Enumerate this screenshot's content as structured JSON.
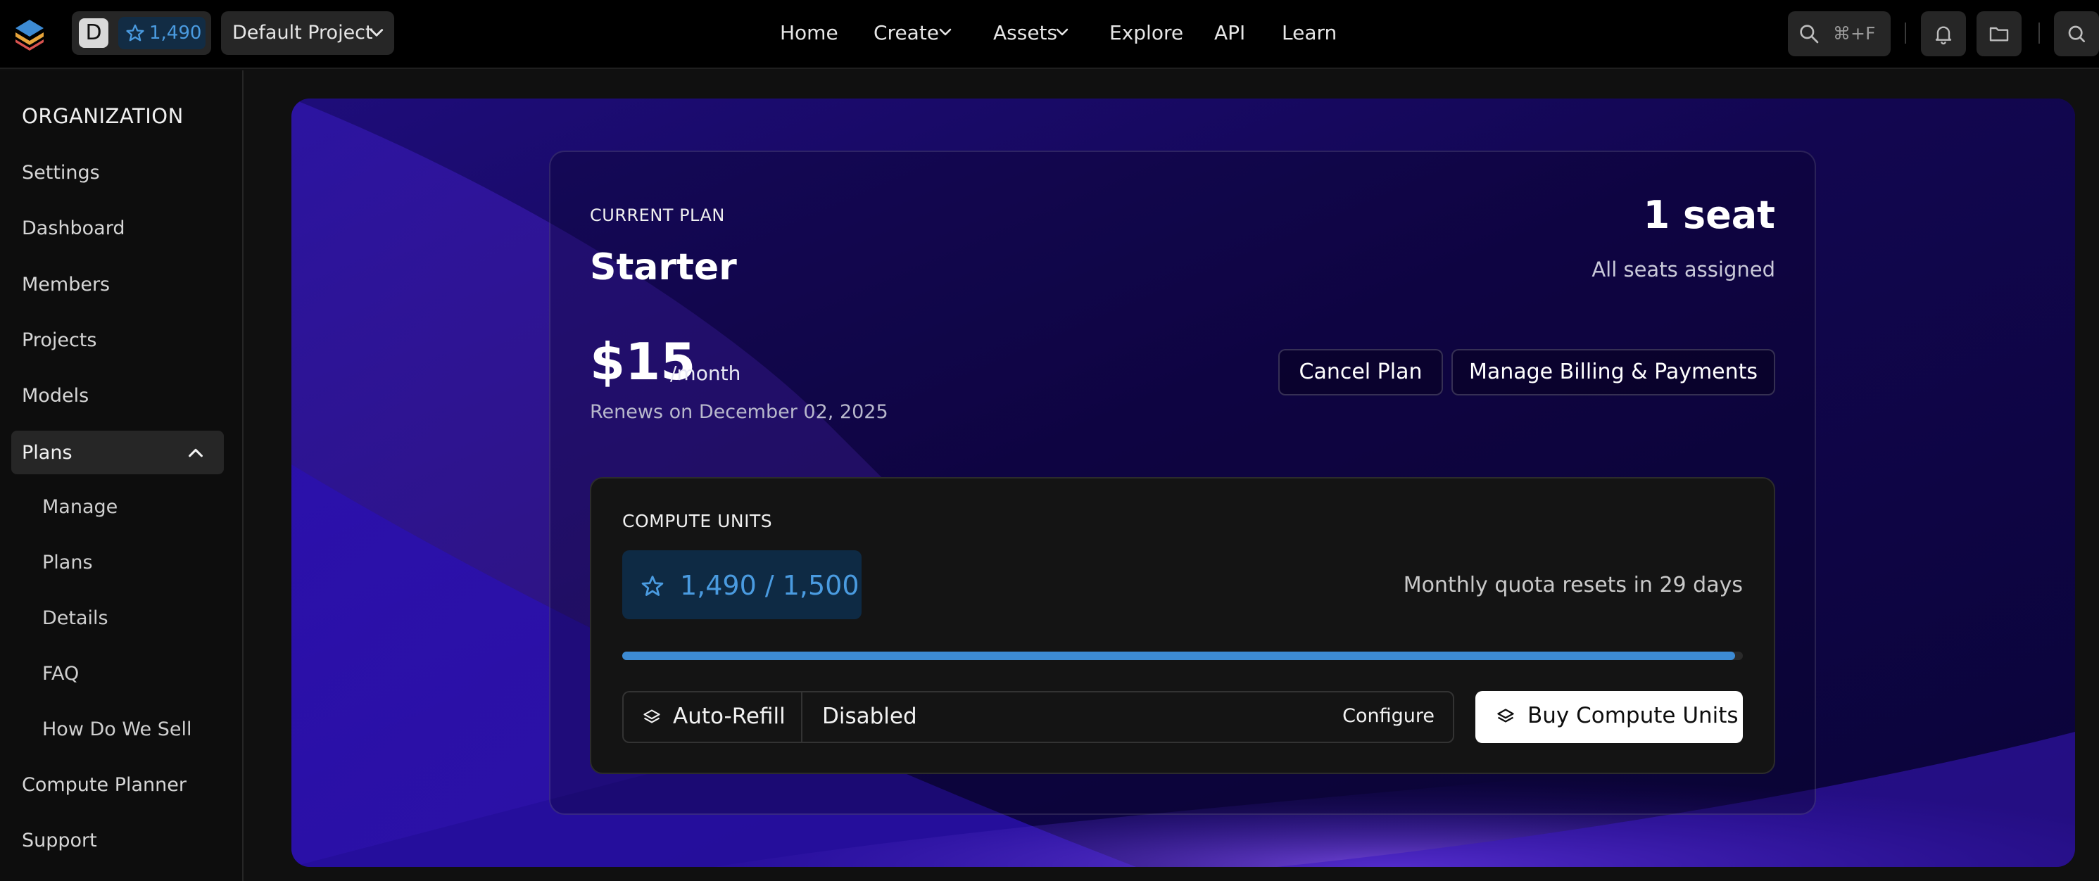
{
  "header": {
    "avatar_initial": "D",
    "credits": "1,490",
    "project": "Default Project",
    "nav": {
      "home": "Home",
      "create": "Create",
      "assets": "Assets",
      "explore": "Explore",
      "api": "API",
      "learn": "Learn"
    },
    "search_shortcut": "⌘+F",
    "icons": [
      "logo-icon",
      "star-icon",
      "chevron-down-icon",
      "search-icon",
      "bell-icon",
      "folder-icon"
    ]
  },
  "sidebar": {
    "heading": "ORGANIZATION",
    "items": {
      "settings": "Settings",
      "dashboard": "Dashboard",
      "members": "Members",
      "projects": "Projects",
      "models": "Models",
      "plans": "Plans",
      "compute_planner": "Compute Planner",
      "support": "Support"
    },
    "plans_sub": {
      "manage": "Manage",
      "plans": "Plans",
      "details": "Details",
      "faq": "FAQ",
      "how_we_sell": "How Do We Sell"
    }
  },
  "plan": {
    "current_label": "CURRENT PLAN",
    "name": "Starter",
    "seats": "1 seat",
    "seats_status": "All seats assigned",
    "price": "$15",
    "period": "/month",
    "renews": "Renews on December 02, 2025",
    "cancel_label": "Cancel Plan",
    "billing_label": "Manage Billing & Payments"
  },
  "compute": {
    "label": "COMPUTE UNITS",
    "usage": "1,490 / 1,500",
    "used": 1490,
    "quota": 1500,
    "reset_text": "Monthly quota resets in 29 days",
    "auto_refill_label": "Auto-Refill",
    "auto_refill_status": "Disabled",
    "configure_label": "Configure",
    "buy_label": "Buy Compute Units"
  },
  "colors": {
    "accent_blue": "#4a9be0",
    "progress_fill": "#3d8bd4",
    "hero_purple": "#1a0a6a"
  }
}
